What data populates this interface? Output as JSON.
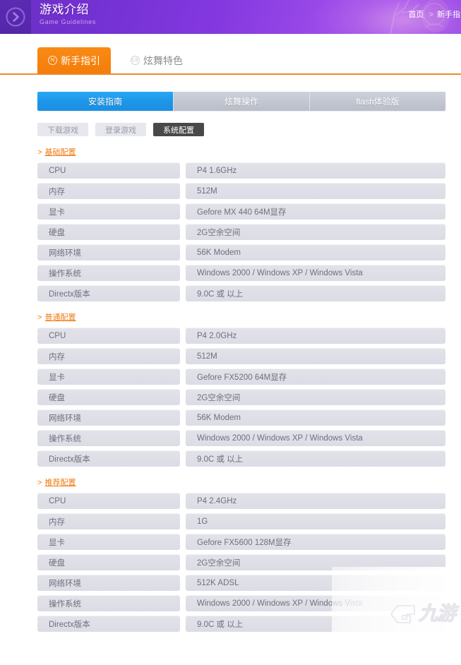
{
  "banner": {
    "title": "游戏介绍",
    "subtitle": "Game Guidelines",
    "leading_icon": "chevron-right-circle-icon",
    "breadcrumb": {
      "home": "首页",
      "separator": ">",
      "current": "新手指引"
    },
    "colors": {
      "gradient_start": "#6a2fc4",
      "gradient_mid": "#8439e0",
      "gradient_end": "#a955ee",
      "icon_box": "#5b2bb2",
      "subtitle_text": "#c9a4ec"
    }
  },
  "top_tabs": {
    "accent": "#f57d0a",
    "underline": "#e98c28",
    "items": [
      {
        "label": "新手指引",
        "badge": "N",
        "badge_icon": "circled-n-icon",
        "active": true
      },
      {
        "label": "炫舞特色",
        "badge": "LS",
        "badge_icon": "circled-ls-icon",
        "active": false
      }
    ]
  },
  "segment_nav": {
    "active_color": "#1e96e8",
    "inactive_color": "#c4c8d2",
    "items": [
      {
        "label": "安装指南",
        "active": true
      },
      {
        "label": "炫舞操作",
        "active": false
      },
      {
        "label": "flash体验版",
        "active": false
      }
    ]
  },
  "sub_buttons": {
    "active_bg": "#494949",
    "inactive_bg": "#e7e7ee",
    "items": [
      {
        "label": "下载游戏",
        "active": false
      },
      {
        "label": "登录游戏",
        "active": false
      },
      {
        "label": "系统配置",
        "active": true
      }
    ]
  },
  "sections": [
    {
      "heading": "基础配置",
      "rows": [
        {
          "label": "CPU",
          "value": "P4 1.6GHz"
        },
        {
          "label": "内存",
          "value": "512M"
        },
        {
          "label": "显卡",
          "value": "Gefore MX 440 64M显存"
        },
        {
          "label": "硬盘",
          "value": "2G空余空间"
        },
        {
          "label": "网络环境",
          "value": "56K Modem"
        },
        {
          "label": "操作系统",
          "value": "Windows 2000 / Windows XP / Windows Vista"
        },
        {
          "label": "Directx版本",
          "value": "9.0C 或 以上"
        }
      ]
    },
    {
      "heading": "普通配置",
      "rows": [
        {
          "label": "CPU",
          "value": "P4 2.0GHz"
        },
        {
          "label": "内存",
          "value": "512M"
        },
        {
          "label": "显卡",
          "value": "Gefore FX5200 64M显存"
        },
        {
          "label": "硬盘",
          "value": "2G空余空间"
        },
        {
          "label": "网络环境",
          "value": "56K Modem"
        },
        {
          "label": "操作系统",
          "value": "Windows 2000 / Windows XP / Windows Vista"
        },
        {
          "label": "Directx版本",
          "value": "9.0C 或 以上"
        }
      ]
    },
    {
      "heading": "推荐配置",
      "rows": [
        {
          "label": "CPU",
          "value": "P4 2.4GHz"
        },
        {
          "label": "内存",
          "value": "1G"
        },
        {
          "label": "显卡",
          "value": "Gefore FX5600 128M显存"
        },
        {
          "label": "硬盘",
          "value": "2G空余空间"
        },
        {
          "label": "网络环境",
          "value": "512K ADSL"
        },
        {
          "label": "操作系统",
          "value": "Windows 2000 / Windows XP / Windows Vista"
        },
        {
          "label": "Directx版本",
          "value": "9.0C 或 以上"
        }
      ]
    }
  ],
  "watermark": {
    "logo_icon": "jiuyou-g-logo-icon",
    "text": "九游"
  }
}
